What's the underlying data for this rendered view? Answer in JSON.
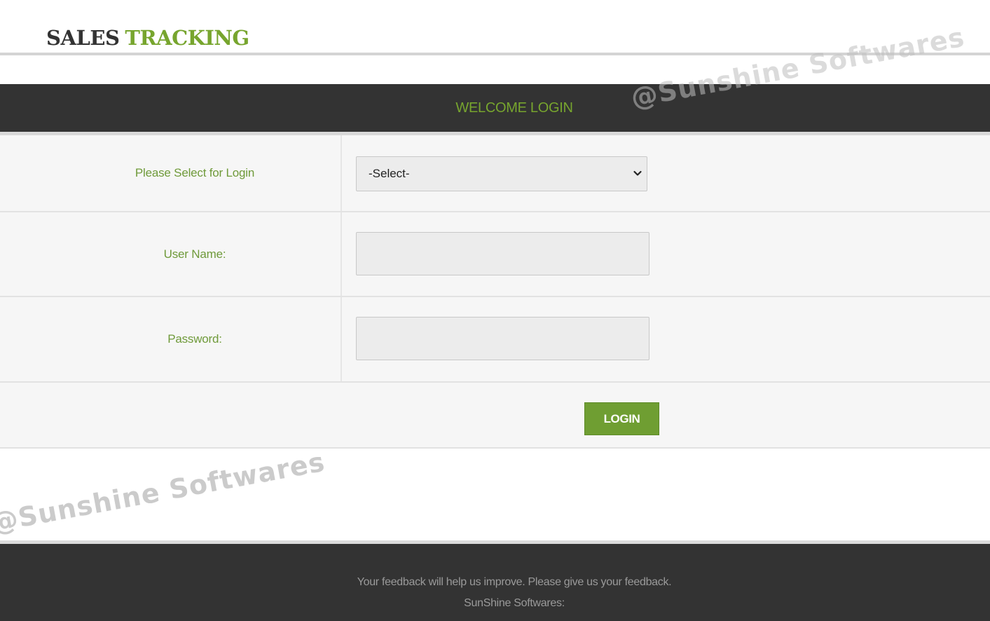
{
  "header": {
    "logo_part1": "SALES",
    "logo_part2": "TRACKING"
  },
  "panel": {
    "title": "WELCOME LOGIN"
  },
  "form": {
    "role_label": "Please Select for Login",
    "role_selected": "-Select-",
    "username_label": "User Name:",
    "username_value": "",
    "password_label": "Password:",
    "password_value": "",
    "login_button": "LOGIN"
  },
  "footer": {
    "line1": "Your feedback will help us improve. Please give us your feedback.",
    "line2": "SunShine Softwares:"
  },
  "watermark": {
    "text": "@Sunshine Softwares"
  },
  "colors": {
    "accent": "#77a52e",
    "dark": "#333333",
    "button": "#6f9e32"
  }
}
